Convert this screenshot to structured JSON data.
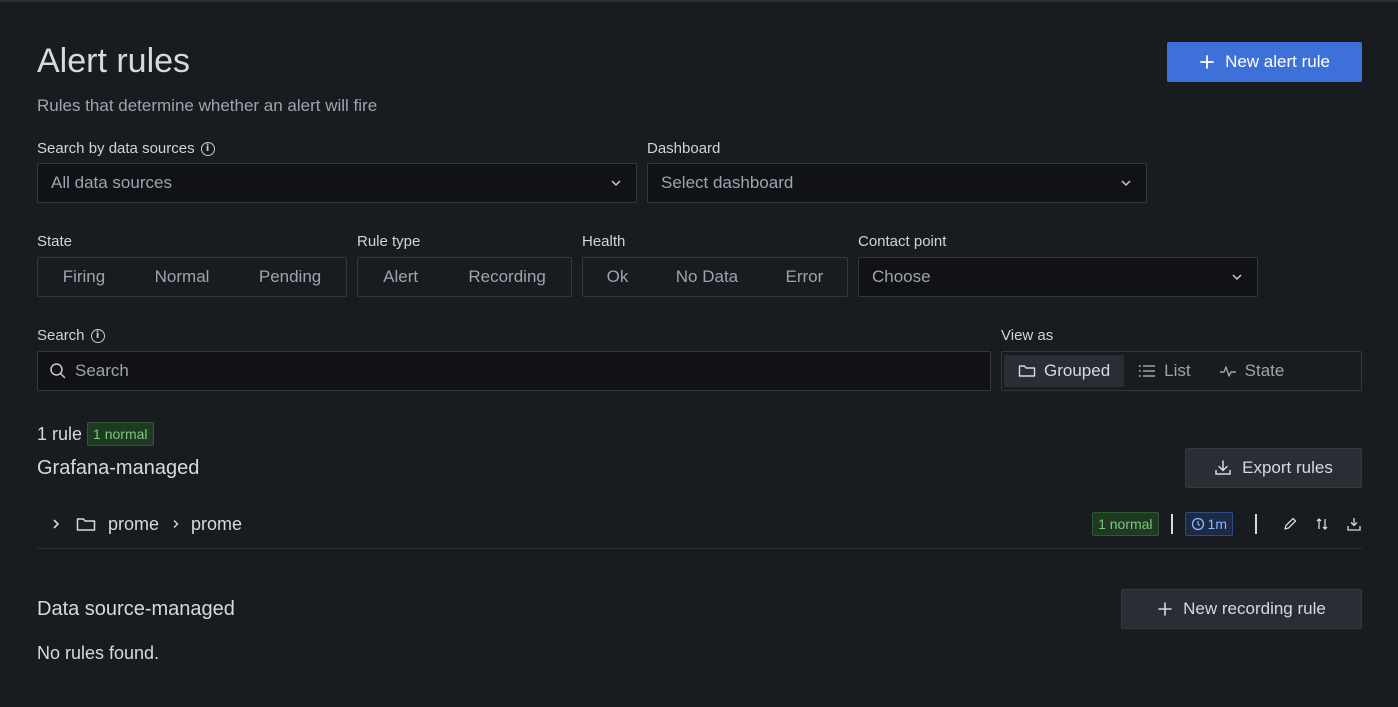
{
  "header": {
    "title": "Alert rules",
    "subtitle": "Rules that determine whether an alert will fire",
    "new_alert_rule_label": "New alert rule"
  },
  "filters": {
    "data_sources": {
      "label": "Search by data sources",
      "value": "All data sources"
    },
    "dashboard": {
      "label": "Dashboard",
      "placeholder": "Select dashboard"
    },
    "state": {
      "label": "State",
      "options": [
        "Firing",
        "Normal",
        "Pending"
      ]
    },
    "rule_type": {
      "label": "Rule type",
      "options": [
        "Alert",
        "Recording"
      ]
    },
    "health": {
      "label": "Health",
      "options": [
        "Ok",
        "No Data",
        "Error"
      ]
    },
    "contact_point": {
      "label": "Contact point",
      "placeholder": "Choose"
    },
    "search": {
      "label": "Search",
      "placeholder": "Search"
    },
    "view_as": {
      "label": "View as",
      "options": [
        "Grouped",
        "List",
        "State"
      ],
      "selected": "Grouped"
    }
  },
  "summary": {
    "count_label": "1 rule",
    "badge": "1 normal"
  },
  "grafana_managed": {
    "title": "Grafana-managed",
    "export_label": "Export rules",
    "groups": [
      {
        "folder": "prome",
        "group": "prome",
        "badge": "1 normal",
        "interval": "1m"
      }
    ]
  },
  "datasource_managed": {
    "title": "Data source-managed",
    "new_recording_rule_label": "New recording rule",
    "empty_text": "No rules found."
  },
  "colors": {
    "primary": "#3d71d9",
    "background": "#181b1f",
    "success": "#7ec77f",
    "info": "#8ab8ff"
  }
}
